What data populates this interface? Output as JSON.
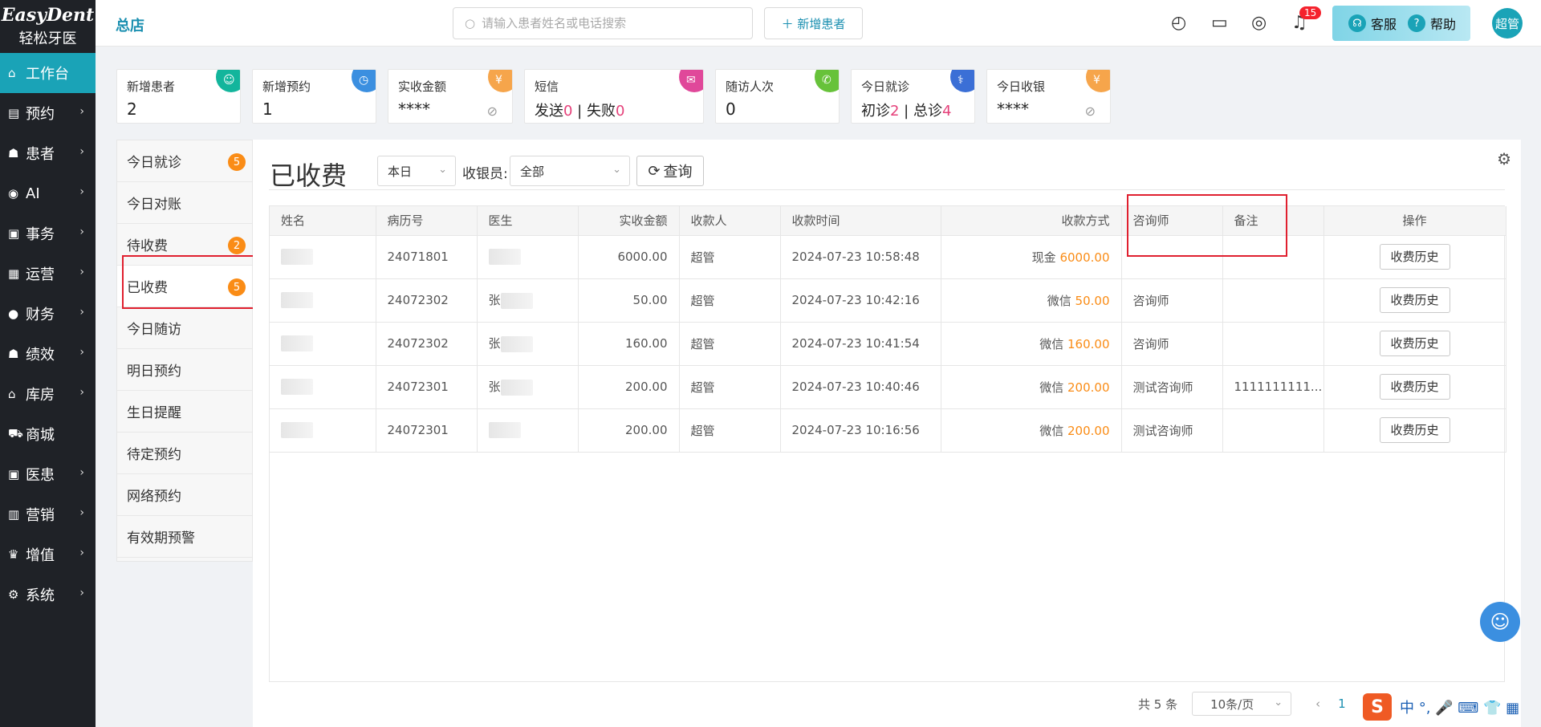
{
  "app": {
    "logo_top": "EasyDent",
    "logo_bottom": "轻松牙医",
    "store": "总店"
  },
  "nav": [
    {
      "icon": "⌂",
      "label": "工作台",
      "active": true,
      "chev": ""
    },
    {
      "icon": "▤",
      "label": "预约",
      "chev": "›"
    },
    {
      "icon": "☗",
      "label": "患者",
      "chev": "›"
    },
    {
      "icon": "◉",
      "label": "AI",
      "chev": "›"
    },
    {
      "icon": "▣",
      "label": "事务",
      "chev": "›"
    },
    {
      "icon": "▦",
      "label": "运营",
      "chev": "›"
    },
    {
      "icon": "●",
      "label": "财务",
      "chev": "›"
    },
    {
      "icon": "☗",
      "label": "绩效",
      "chev": "›"
    },
    {
      "icon": "⌂",
      "label": "库房",
      "chev": "›"
    },
    {
      "icon": "⛟",
      "label": "商城",
      "chev": ""
    },
    {
      "icon": "▣",
      "label": "医患",
      "chev": "›"
    },
    {
      "icon": "▥",
      "label": "营销",
      "chev": "›"
    },
    {
      "icon": "♛",
      "label": "增值",
      "chev": "›"
    },
    {
      "icon": "⚙",
      "label": "系统",
      "chev": "›"
    }
  ],
  "topbar": {
    "search_placeholder": "请输入患者姓名或电话搜索",
    "add_patient": "＋ 新增患者",
    "bell_count": "15",
    "service": "客服",
    "help": "帮助",
    "user": "超管"
  },
  "cards": [
    {
      "title": "新增患者",
      "value": "2",
      "color": "#13b59c",
      "icon": "☺"
    },
    {
      "title": "新增预约",
      "value": "1",
      "color": "#3b8fe0",
      "icon": "◷"
    },
    {
      "title": "实收金额",
      "value": "****",
      "color": "#f6a54b",
      "icon": "¥",
      "eye": true
    },
    {
      "title": "短信",
      "value_pre": "发送",
      "v1": "0",
      "sep": " | 失败",
      "v2": "0",
      "color": "#e0489a",
      "icon": "✉"
    },
    {
      "title": "随访人次",
      "value": "0",
      "color": "#67c23a",
      "icon": "✆"
    },
    {
      "title": "今日就诊",
      "value_pre": "初诊",
      "v1": "2",
      "sep": " | 总诊",
      "v2": "4",
      "color": "#3b6fd6",
      "icon": "⚕"
    },
    {
      "title": "今日收银",
      "value": "****",
      "color": "#f6a54b",
      "icon": "¥",
      "eye": true
    }
  ],
  "submenu": [
    {
      "label": "今日就诊",
      "badge": "5"
    },
    {
      "label": "今日对账",
      "badge": ""
    },
    {
      "label": "待收费",
      "badge": "2"
    },
    {
      "label": "已收费",
      "badge": "5",
      "active": true
    },
    {
      "label": "今日随访",
      "badge": ""
    },
    {
      "label": "明日预约",
      "badge": ""
    },
    {
      "label": "生日提醒",
      "badge": ""
    },
    {
      "label": "待定预约",
      "badge": ""
    },
    {
      "label": "网络预约",
      "badge": ""
    },
    {
      "label": "有效期预警",
      "badge": ""
    }
  ],
  "main": {
    "title": "已收费",
    "period": "本日",
    "cashier_label": "收银员:",
    "cashier_value": "全部",
    "query": "查询"
  },
  "table": {
    "headers": [
      "姓名",
      "病历号",
      "医生",
      "实收金额",
      "收款人",
      "收款时间",
      "收款方式",
      "咨询师",
      "备注",
      "操作"
    ],
    "rows": [
      {
        "record": "24071801",
        "doctor": "",
        "amount": "6000.00",
        "payee": "超管",
        "time": "2024-07-23 10:58:48",
        "method": "现金",
        "method_amt": "6000.00",
        "consultant": "",
        "note": "",
        "action": "收费历史"
      },
      {
        "record": "24072302",
        "doctor": "张",
        "amount": "50.00",
        "payee": "超管",
        "time": "2024-07-23 10:42:16",
        "method": "微信",
        "method_amt": "50.00",
        "consultant": "咨询师",
        "note": "",
        "action": "收费历史"
      },
      {
        "record": "24072302",
        "doctor": "张",
        "amount": "160.00",
        "payee": "超管",
        "time": "2024-07-23 10:41:54",
        "method": "微信",
        "method_amt": "160.00",
        "consultant": "咨询师",
        "note": "",
        "action": "收费历史"
      },
      {
        "record": "24072301",
        "doctor": "张",
        "amount": "200.00",
        "payee": "超管",
        "time": "2024-07-23 10:40:46",
        "method": "微信",
        "method_amt": "200.00",
        "consultant": "测试咨询师",
        "note": "1111111111...",
        "action": "收费历史"
      },
      {
        "record": "24072301",
        "doctor": "",
        "amount": "200.00",
        "payee": "超管",
        "time": "2024-07-23 10:16:56",
        "method": "微信",
        "method_amt": "200.00",
        "consultant": "测试咨询师",
        "note": "",
        "action": "收费历史"
      }
    ]
  },
  "pager": {
    "total": "共 5 条",
    "size": "10条/页",
    "prev": "‹",
    "current": "1"
  },
  "ime": {
    "logo": "S",
    "text": "中 °, 🎤 ⌨ 👕 ▦"
  }
}
